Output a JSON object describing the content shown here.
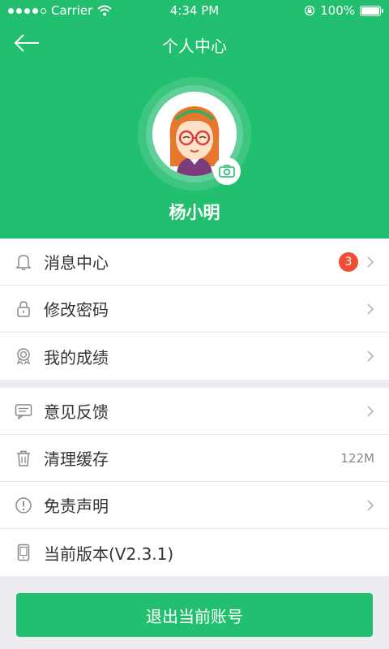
{
  "status_bar": {
    "carrier": "Carrier",
    "time": "4:34 PM",
    "battery_percent": "100%",
    "battery_level": 1.0,
    "signal_bars": 4
  },
  "nav": {
    "title": "个人中心",
    "back_icon": "arrow-left-icon"
  },
  "profile": {
    "name": "杨小明",
    "camera_icon": "camera-icon"
  },
  "menu_group_1": [
    {
      "label": "消息中心",
      "icon": "bell-icon",
      "badge": "3"
    },
    {
      "label": "修改密码",
      "icon": "lock-icon"
    },
    {
      "label": "我的成绩",
      "icon": "medal-icon"
    }
  ],
  "menu_group_2": [
    {
      "label": "意见反馈",
      "icon": "feedback-icon"
    },
    {
      "label": "清理缓存",
      "icon": "trash-icon",
      "value": "122M"
    },
    {
      "label": "免责声明",
      "icon": "exclamation-icon"
    },
    {
      "label": "当前版本(V2.3.1)",
      "icon": "phone-icon"
    }
  ],
  "logout": {
    "label": "退出当前账号"
  },
  "colors": {
    "accent": "#22bf6f",
    "badge": "#ef4e34",
    "background": "#ececf1"
  }
}
